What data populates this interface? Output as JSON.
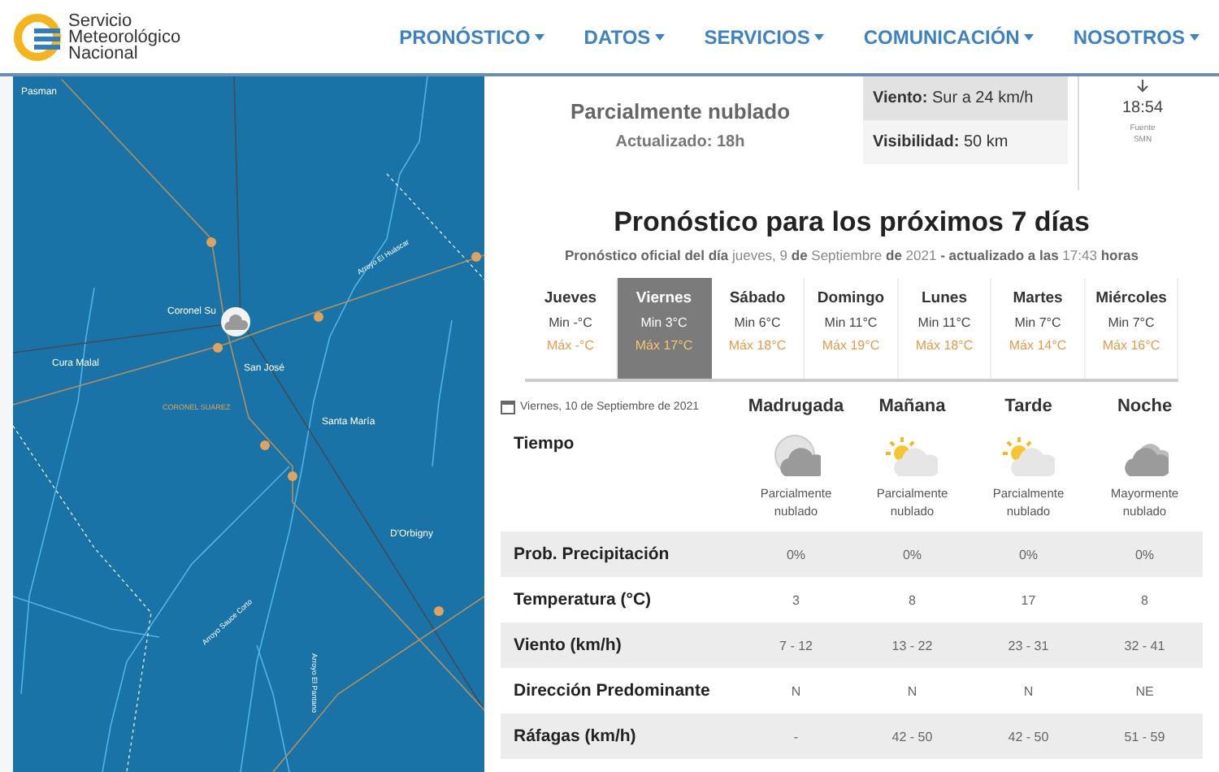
{
  "header": {
    "logo_lines": [
      "Servicio",
      "Meteorológico",
      "Nacional"
    ],
    "nav": [
      {
        "label": "PRONÓSTICO"
      },
      {
        "label": "DATOS"
      },
      {
        "label": "SERVICIOS"
      },
      {
        "label": "COMUNICACIÓN"
      },
      {
        "label": "NOSOTROS"
      }
    ]
  },
  "map": {
    "labels": [
      {
        "text": "Pasman",
        "kind": "town"
      },
      {
        "text": "Coronel Su",
        "kind": "town"
      },
      {
        "text": "Cura Malal",
        "kind": "town"
      },
      {
        "text": "San José",
        "kind": "town"
      },
      {
        "text": "CORONEL SUAREZ",
        "kind": "district"
      },
      {
        "text": "Santa María",
        "kind": "town"
      },
      {
        "text": "D'Orbigny",
        "kind": "town"
      },
      {
        "text": "Arroyo El Huáscar",
        "kind": "river"
      },
      {
        "text": "Arroyo Sauce Corto",
        "kind": "river"
      },
      {
        "text": "Arroyo El Pantano",
        "kind": "river"
      }
    ]
  },
  "current": {
    "condition": "Parcialmente nublado",
    "updated": "Actualizado: 18h",
    "wind": "**Viento:** Sur a 24 km/h",
    "visibility": "**Visibilidad:** 50 km",
    "time": "18:54",
    "source_lines": [
      "Fuente",
      "SMN"
    ]
  },
  "forecast": {
    "title": "Pronóstico para los próximos 7 días",
    "subtitle": "**Pronóstico oficial del día** jueves, 9 **de** Septiembre **de** 2021 **- actualizado a las** 17:43 **horas**",
    "days": [
      {
        "name": "Jueves",
        "min": "Min -°C",
        "max": "Máx -°C",
        "selected": false
      },
      {
        "name": "Viernes",
        "min": "Min 3°C",
        "max": "Máx 17°C",
        "selected": true
      },
      {
        "name": "Sábado",
        "min": "Min 6°C",
        "max": "Máx 18°C",
        "selected": false
      },
      {
        "name": "Domingo",
        "min": "Min 11°C",
        "max": "Máx 19°C",
        "selected": false
      },
      {
        "name": "Lunes",
        "min": "Min 11°C",
        "max": "Máx 18°C",
        "selected": false
      },
      {
        "name": "Martes",
        "min": "Min 7°C",
        "max": "Máx 14°C",
        "selected": false
      },
      {
        "name": "Miércoles",
        "min": "Min 7°C",
        "max": "Máx 16°C",
        "selected": false
      }
    ],
    "date": "Viernes, 10 de Septiembre de 2021",
    "periods": [
      {
        "name": "Madrugada",
        "kind": "moon-cloud",
        "sky": "Parcialmente nublado"
      },
      {
        "name": "Mañana",
        "kind": "sun-cloud",
        "sky": "Parcialmente nublado"
      },
      {
        "name": "Tarde",
        "kind": "sun-cloud",
        "sky": "Parcialmente nublado"
      },
      {
        "name": "Noche",
        "kind": "cloud",
        "sky": "Mayormente nublado"
      }
    ],
    "weather_label": "Tiempo",
    "rows": [
      {
        "label": "Prob. Precipitación",
        "values": [
          "0%",
          "0%",
          "0%",
          "0%"
        ]
      },
      {
        "label": "Temperatura (°C)",
        "values": [
          "3",
          "8",
          "17",
          "8"
        ]
      },
      {
        "label": "Viento (km/h)",
        "values": [
          "7 - 12",
          "13 - 22",
          "23 - 31",
          "32 - 41"
        ]
      },
      {
        "label": "Dirección Predominante",
        "values": [
          "N",
          "N",
          "N",
          "NE"
        ]
      },
      {
        "label": "Ráfagas (km/h)",
        "values": [
          "-",
          "42 - 50",
          "42 - 50",
          "51 - 59"
        ]
      }
    ]
  }
}
